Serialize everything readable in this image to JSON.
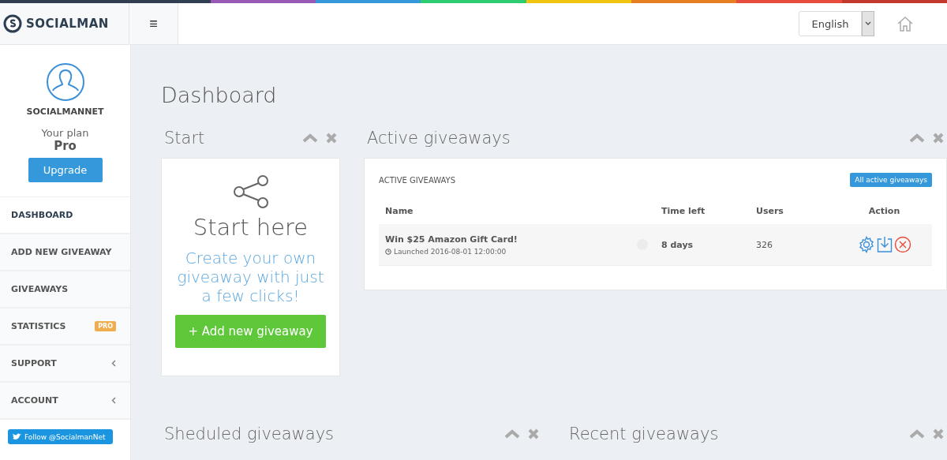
{
  "header": {
    "logo": "SOCIALMAN",
    "menu_glyph": "≡",
    "language": {
      "value": "English"
    }
  },
  "profile": {
    "username": "SOCIALMANNET",
    "plan_label": "Your plan",
    "plan": "Pro",
    "upgrade": "Upgrade"
  },
  "sidebar": {
    "items": [
      {
        "label": "DASHBOARD",
        "selected": true
      },
      {
        "label": "ADD NEW GIVEAWAY",
        "selected": false
      },
      {
        "label": "GIVEAWAYS",
        "selected": false
      },
      {
        "label": "STATISTICS",
        "selected": false,
        "badge": "PRO"
      },
      {
        "label": "SUPPORT",
        "selected": false,
        "expandable": true
      },
      {
        "label": "ACCOUNT",
        "selected": false,
        "expandable": true
      }
    ],
    "follow": "Follow @SocialmanNet"
  },
  "page_title": "Dashboard",
  "start_panel": {
    "title": "Start",
    "heading": "Start here",
    "text": "Create your own giveaway with just a few clicks!",
    "button": "+ Add new giveaway"
  },
  "active_panel": {
    "title": "Active giveaways",
    "card_title": "ACTIVE GIVEAWAYS",
    "all_button": "All active giveaways",
    "columns": [
      "Name",
      "Time left",
      "Users",
      "Action"
    ],
    "rows": [
      {
        "name": "Win $25 Amazon Gift Card!",
        "launched": "Launched 2016-08-01 12:00:00",
        "time_left": "8 days",
        "users": "326"
      }
    ]
  },
  "bottom_panels": [
    {
      "title": "Sheduled giveaways"
    },
    {
      "title": "Recent giveaways"
    }
  ]
}
